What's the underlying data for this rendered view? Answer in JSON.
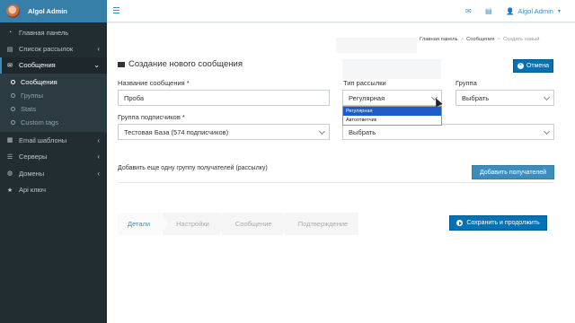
{
  "sidebar": {
    "user_name": "Algol Admin",
    "items": [
      {
        "label": "Главная панель",
        "icon": "dashboard-icon"
      },
      {
        "label": "Список рассылок",
        "icon": "list-icon"
      },
      {
        "label": "Сообщения",
        "icon": "envelope-icon"
      },
      {
        "label": "Email шаблоны",
        "icon": "template-icon"
      },
      {
        "label": "Серверы",
        "icon": "server-icon"
      },
      {
        "label": "Домены",
        "icon": "globe-icon"
      },
      {
        "label": "Api ключ",
        "icon": "star-icon"
      }
    ],
    "subitems": [
      "Сообщения",
      "Группы",
      "Stats",
      "Custom tags"
    ]
  },
  "topbar": {
    "user_name": "Algol Admin",
    "icons": [
      "hamburger-icon",
      "mail-icon",
      "doc-icon",
      "user-icon"
    ]
  },
  "breadcrumb": [
    "Главная панель",
    "Сообщения",
    "Создать новый"
  ],
  "page": {
    "title": "Создание нового сообщения",
    "cancel_label": "Отмена"
  },
  "form": {
    "name_label": "Название сообщения *",
    "name_value": "Проба",
    "type_label": "Тип рассылки",
    "type_value": "Регулярная",
    "type_options": [
      "Регулярная",
      "Автоответчик"
    ],
    "group_label": "Группа",
    "group_value": "Выбрать",
    "subscribers_label": "Группа подписчиков *",
    "subscribers_value": "Тестовая База (574 подписчиков)",
    "second_select_value": "Выбрать",
    "add_text": "Добавить еще одну группу получателей (рассылку)",
    "add_button": "Добавить получателей"
  },
  "steps": [
    "Детали",
    "Настройки",
    "Сообщение",
    "Подтверждение"
  ],
  "save_label": "Сохранить и продолжить",
  "colors": {
    "accent": "#3c8dbc",
    "sidebar": "#222d32",
    "primary_button": "#0073b7"
  }
}
